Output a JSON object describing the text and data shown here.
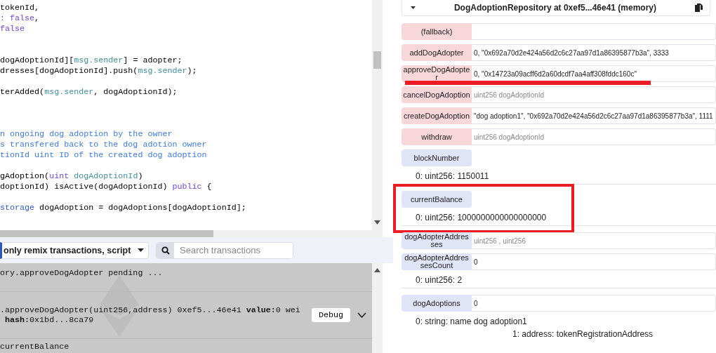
{
  "editor": {
    "lines": [
      {
        "kind": "code",
        "segments": [
          {
            "kind": "plain",
            "text": "tokenId,"
          }
        ]
      },
      {
        "kind": "code",
        "segments": [
          {
            "kind": "keyword",
            "text": ": "
          },
          {
            "kind": "literal",
            "text": "false"
          },
          {
            "kind": "plain",
            "text": ","
          }
        ]
      },
      {
        "kind": "code",
        "segments": [
          {
            "kind": "literal",
            "text": "false"
          }
        ]
      },
      {
        "kind": "blank"
      },
      {
        "kind": "blank"
      },
      {
        "kind": "code",
        "segments": [
          {
            "kind": "plain",
            "text": "dogAdoptionId]["
          },
          {
            "kind": "var",
            "text": "msg.sender"
          },
          {
            "kind": "plain",
            "text": "] = adopter;"
          }
        ]
      },
      {
        "kind": "code",
        "segments": [
          {
            "kind": "plain",
            "text": "dresses[dogAdoptionId].push("
          },
          {
            "kind": "var",
            "text": "msg.sender"
          },
          {
            "kind": "plain",
            "text": ");"
          }
        ]
      },
      {
        "kind": "blank"
      },
      {
        "kind": "code",
        "segments": [
          {
            "kind": "plain",
            "text": "terAdded("
          },
          {
            "kind": "var",
            "text": "msg.sender"
          },
          {
            "kind": "plain",
            "text": ", dogAdoptionId);"
          }
        ]
      },
      {
        "kind": "blank"
      },
      {
        "kind": "blank"
      },
      {
        "kind": "blank"
      },
      {
        "kind": "code",
        "segments": [
          {
            "kind": "comment",
            "text": "n ongoing dog adoption by the owner"
          }
        ]
      },
      {
        "kind": "code",
        "segments": [
          {
            "kind": "comment",
            "text": "s transfered back to the dog adotion owner"
          }
        ]
      },
      {
        "kind": "code",
        "segments": [
          {
            "kind": "comment",
            "text": "tionId uint ID of the created dog adoption"
          }
        ]
      },
      {
        "kind": "blank"
      },
      {
        "kind": "code",
        "segments": [
          {
            "kind": "plain",
            "text": "gAdoption("
          },
          {
            "kind": "literal",
            "text": "uint "
          },
          {
            "kind": "var",
            "text": "dogAdoptionId"
          },
          {
            "kind": "plain",
            "text": ")"
          }
        ]
      },
      {
        "kind": "code",
        "segments": [
          {
            "kind": "plain",
            "text": "doptionId) isActive(dogAdoptionId) "
          },
          {
            "kind": "literal",
            "text": "public"
          },
          {
            "kind": "plain",
            "text": " {"
          }
        ]
      },
      {
        "kind": "blank"
      },
      {
        "kind": "code",
        "segments": [
          {
            "kind": "keyword",
            "text": "storage"
          },
          {
            "kind": "plain",
            "text": " dogAdoption = dogAdoptions[dogAdoptionId];"
          }
        ]
      }
    ]
  },
  "terminal": {
    "filter": "only remix transactions, script",
    "search": {
      "placeholder": "Search transactions"
    },
    "log": [
      {
        "kind": "pending",
        "text": "ory.approveDogAdopter pending ..."
      },
      {
        "kind": "tx",
        "text": ".approveDogAdopter(uint256,address) 0xef5...46e41 **value:**0 wei",
        "detail": "**hash:**0x1bd...8ca79",
        "button": "Debug"
      },
      {
        "kind": "call",
        "text": "currentBalance"
      }
    ]
  },
  "contract": {
    "title": "DogAdoptionRepository at 0xef5...46e41 (memory)",
    "functions": [
      {
        "kind": "transact",
        "name": "(fallback)",
        "has_input": true
      },
      {
        "kind": "transact",
        "name": "addDogAdopter",
        "has_input": true,
        "value": "0, \"0x692a70d2e424a56d2c6c27aa97d1a86395877b3a\", 3333"
      },
      {
        "kind": "transact",
        "name": "approveDogAdopter",
        "has_input": true,
        "value": "0, \"0x14723a09acff6d2a60dcdf7aa4aff308fddc160c\"",
        "underlined": true
      },
      {
        "kind": "transact",
        "name": "cancelDogAdoption",
        "has_input": true,
        "placeholder": "uint256 dogAdoptionId"
      },
      {
        "kind": "transact",
        "name": "createDogAdoption",
        "has_input": true,
        "value": "\"dog adoption1\", \"0x692a70d2e424a56d2c6c27aa97d1a86395877b3a\", 1111"
      },
      {
        "kind": "transact",
        "name": "withdraw",
        "has_input": true,
        "placeholder": "uint256 dogAdoptionId"
      },
      {
        "kind": "call",
        "name": "blockNumber",
        "has_input": false,
        "results": [
          "0: uint256: 1150011"
        ]
      },
      {
        "kind": "call",
        "name": "currentBalance",
        "has_input": false,
        "results": [
          "0: uint256: 1000000000000000000"
        ],
        "highlighted": true
      },
      {
        "kind": "call",
        "name": "dogAdopterAddresses",
        "has_input": true,
        "placeholder": "uint256 , uint256"
      },
      {
        "kind": "call",
        "name": "dogAdopterAddressesCount",
        "has_input": true,
        "value": "0",
        "results": [
          "0: uint256: 2"
        ]
      },
      {
        "kind": "call",
        "name": "dogAdoptions",
        "has_input": true,
        "value": "0",
        "results": [
          "0: string: name dog adoption1",
          "1: address: tokenRegistrationAddress"
        ]
      }
    ]
  }
}
